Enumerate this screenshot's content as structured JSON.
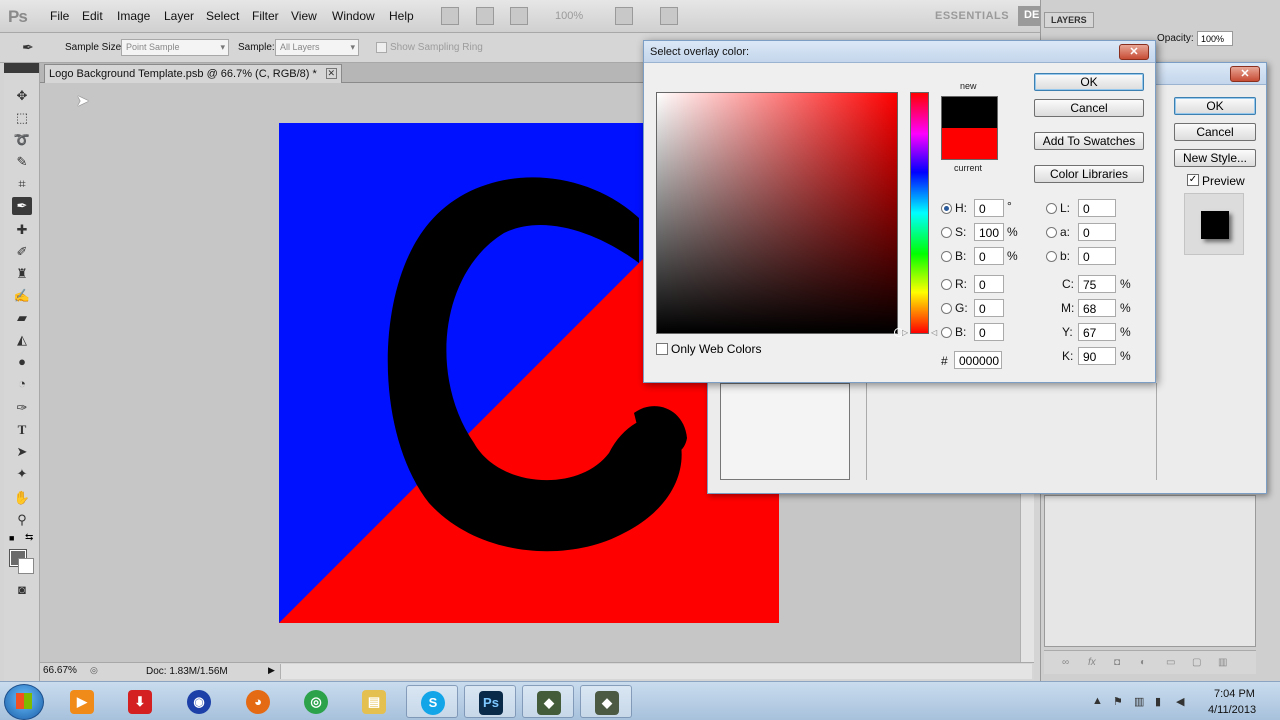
{
  "menubar": {
    "logo": "Ps",
    "items": [
      "File",
      "Edit",
      "Image",
      "Layer",
      "Select",
      "Filter",
      "View",
      "Window",
      "Help"
    ],
    "zoom": "100%",
    "workspace_essentials": "ESSENTIALS",
    "workspace_design": "DE"
  },
  "options": {
    "sample_size_label": "Sample Size:",
    "sample_size_value": "Point Sample",
    "sample_label": "Sample:",
    "sample_value": "All Layers",
    "show_ring_label": "Show Sampling Ring"
  },
  "document": {
    "tab_title": "Logo Background Template.psb @ 66.7% (C, RGB/8) *",
    "tab_close": "✕",
    "zoom": "66.67%",
    "doc_info": "Doc: 1.83M/1.56M",
    "canvas_colors": {
      "blue": "#0011ff",
      "red": "#ff0000",
      "letter": "#000000"
    }
  },
  "layers": {
    "tab": "LAYERS",
    "opacity_label": "Opacity:",
    "opacity_value": "100%",
    "footer_icons": [
      "link-icon",
      "fx-icon",
      "mask-icon",
      "adjustment-icon",
      "folder-icon",
      "new-layer-icon",
      "trash-icon"
    ]
  },
  "layer_style": {
    "ok": "OK",
    "cancel": "Cancel",
    "new_style": "New Style...",
    "preview_label": "Preview",
    "preview_checked": true
  },
  "picker": {
    "title": "Select overlay color:",
    "ok": "OK",
    "cancel": "Cancel",
    "add_swatches": "Add To Swatches",
    "color_libraries": "Color Libraries",
    "new_label": "new",
    "current_label": "current",
    "new_color": "#000000",
    "current_color": "#ff0000",
    "only_web_colors": "Only Web Colors",
    "fields": {
      "H": "0",
      "S": "100",
      "B": "0",
      "R": "0",
      "G": "0",
      "Bv": "0",
      "L": "0",
      "a": "0",
      "b": "0",
      "C": "75",
      "M": "68",
      "Y": "67",
      "K": "90",
      "hex": "000000"
    },
    "labels": {
      "H": "H:",
      "S": "S:",
      "B": "B:",
      "R": "R:",
      "G": "G:",
      "Bv": "B:",
      "L": "L:",
      "a": "a:",
      "b": "b:",
      "C": "C:",
      "M": "M:",
      "Y": "Y:",
      "K": "K:",
      "hash": "#",
      "deg": "°",
      "pct": "%"
    }
  },
  "taskbar": {
    "time": "7:04 PM",
    "date": "4/11/2013",
    "apps": [
      "windows-media-player",
      "download-manager",
      "globe-app",
      "firefox",
      "chrome",
      "file-explorer",
      "skype",
      "photoshop",
      "app-1",
      "app-2"
    ]
  }
}
